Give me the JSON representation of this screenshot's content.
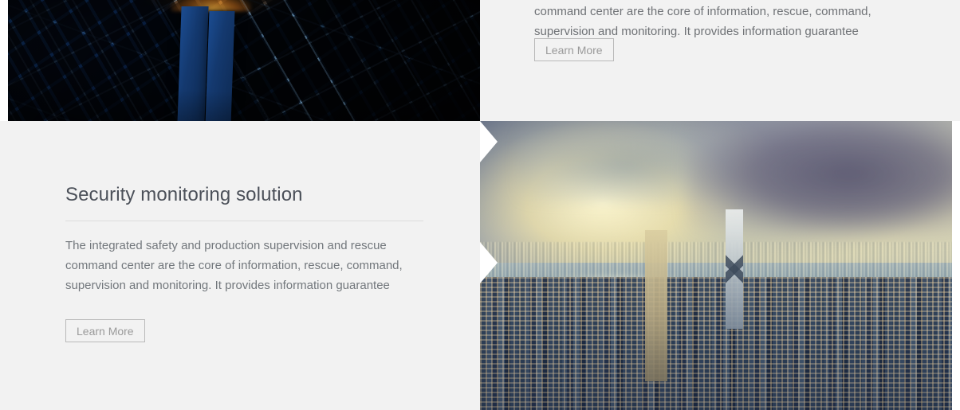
{
  "page": {
    "background_color": "#ffffff",
    "panel_color": "#f2f2f2"
  },
  "top_section": {
    "image": {
      "name": "aerial-night-city-image",
      "alt": "Aerial night view of a dense city grid with glowing streets and two blue towers"
    },
    "text_panel": {
      "paragraph": "The integrated safety and production supervision and rescue command center are the core of information, rescue, command, supervision and monitoring. It provides information guarantee",
      "learn_more_label": "Learn More"
    }
  },
  "feature_section": {
    "title": "Security monitoring solution",
    "paragraph": "The integrated safety and production supervision and rescue command center are the core of information, rescue, command, supervision and monitoring. It provides information guarantee",
    "learn_more_label": "Learn More",
    "image": {
      "name": "harbour-dusk-city-image",
      "alt": "Hong Kong harbour skyline at dusk with hazy golden sky"
    }
  },
  "colors": {
    "title_text": "#4b5059",
    "body_text": "#72777c",
    "button_border": "#b9b9b9",
    "button_text": "#9a9a9a",
    "divider": "#dcdcdc",
    "panel_bg": "#f2f2f2"
  }
}
